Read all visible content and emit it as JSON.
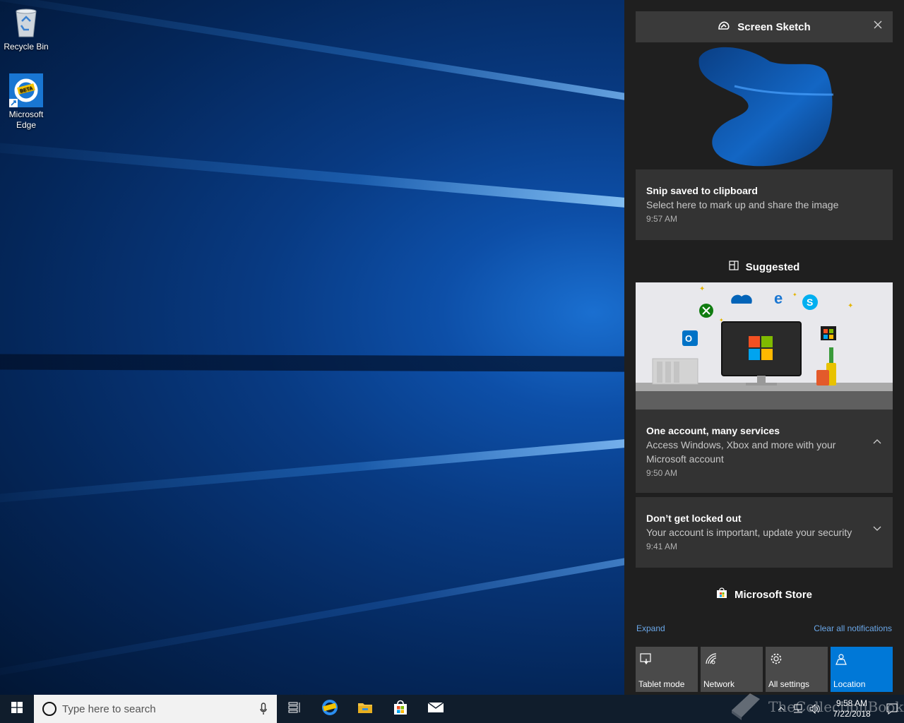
{
  "desktop": {
    "icons": [
      {
        "label": "Recycle Bin",
        "icon": "recycle-bin-icon"
      },
      {
        "label": "Microsoft Edge",
        "icon": "edge-beta-icon",
        "badge": "BETA"
      }
    ]
  },
  "action_center": {
    "screen_sketch": {
      "header": "Screen Sketch",
      "icon": "screen-sketch-icon",
      "notification": {
        "title": "Snip saved to clipboard",
        "body": "Select here to mark up and share the image",
        "time": "9:57 AM"
      }
    },
    "suggested": {
      "header": "Suggested",
      "icon": "tips-icon",
      "notifications": [
        {
          "title": "One account, many services",
          "body": "Access Windows, Xbox and more with your Microsoft account",
          "time": "9:50 AM",
          "state": "expanded"
        },
        {
          "title": "Don’t get locked out",
          "body": "Your account is important, update your security",
          "time": "9:41 AM",
          "state": "collapsed"
        }
      ]
    },
    "store": {
      "header": "Microsoft Store",
      "icon": "store-icon"
    },
    "expand_link": "Expand",
    "clear_link": "Clear all notifications",
    "quick_actions": [
      {
        "label": "Tablet mode",
        "icon": "tablet-mode-icon",
        "active": false
      },
      {
        "label": "Network",
        "icon": "network-icon",
        "active": false
      },
      {
        "label": "All settings",
        "icon": "gear-icon",
        "active": false
      },
      {
        "label": "Location",
        "icon": "location-icon",
        "active": true
      }
    ]
  },
  "taskbar": {
    "search_placeholder": "Type here to search",
    "pinned": [
      "task-view-icon",
      "edge-beta-icon",
      "file-explorer-icon",
      "store-icon",
      "mail-icon"
    ],
    "clock": {
      "time": "9:58 AM",
      "date": "7/22/2018"
    }
  },
  "watermark": "TheCollectionBook",
  "colors": {
    "accent": "#0078d7",
    "panel": "#1f1f1f",
    "card": "#333333",
    "link": "#6aa7e8"
  }
}
